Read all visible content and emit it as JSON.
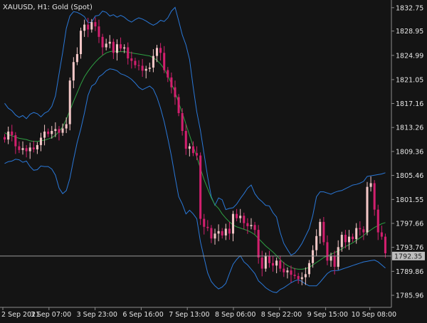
{
  "header": {
    "symbol_info": "XAUUSD, H1:  Gold (Spot)"
  },
  "colors": {
    "background": "#141414",
    "axis": "#8c8c8c",
    "text": "#e6e6e6",
    "bull_candle": "#f2c6c6",
    "bear_candle": "#d21f6e",
    "band": "#2a78d8",
    "middle_band": "#2ea043",
    "price_line": "#9a9a9a",
    "price_tag_bg": "#bdbdbd",
    "price_tag_text": "#202020"
  },
  "chart_data": {
    "type": "candlestick",
    "title": "XAUUSD, H1:  Gold (Spot)",
    "indicator": "Bollinger Bands",
    "y_ticks": [
      "1832.75",
      "1828.95",
      "1824.99",
      "1821.05",
      "1817.16",
      "1813.26",
      "1809.36",
      "1805.46",
      "1801.55",
      "1797.66",
      "1793.76",
      "1789.86",
      "1785.96"
    ],
    "x_ticks": [
      "2 Sep 2021",
      "3 Sep 07:00",
      "3 Sep 23:00",
      "6 Sep 16:00",
      "7 Sep 13:00",
      "8 Sep 06:00",
      "8 Sep 22:00",
      "9 Sep 15:00",
      "10 Sep 08:00"
    ],
    "ylim": [
      1784.0,
      1834.0
    ],
    "current_price": "1792.35",
    "candles_close": [
      1811.3,
      1812.6,
      1812.0,
      1810.2,
      1809.6,
      1809.9,
      1809.4,
      1810.0,
      1809.7,
      1810.4,
      1811.6,
      1812.6,
      1812.2,
      1812.7,
      1813.0,
      1812.4,
      1813.1,
      1813.8,
      1820.9,
      1823.9,
      1825.2,
      1829.0,
      1830.0,
      1829.2,
      1830.4,
      1829.7,
      1828.0,
      1826.3,
      1826.9,
      1827.2,
      1825.4,
      1826.8,
      1826.1,
      1826.3,
      1824.5,
      1824.1,
      1823.4,
      1823.3,
      1822.5,
      1822.8,
      1823.0,
      1824.9,
      1826.2,
      1825.4,
      1822.6,
      1821.4,
      1819.8,
      1818.2,
      1815.6,
      1812.7,
      1809.8,
      1810.2,
      1809.1,
      1808.7,
      1798.4,
      1797.1,
      1796.9,
      1795.2,
      1796.0,
      1796.4,
      1795.7,
      1796.8,
      1796.0,
      1799.2,
      1798.5,
      1798.9,
      1797.7,
      1797.2,
      1797.4,
      1796.6,
      1792.1,
      1790.3,
      1792.4,
      1791.2,
      1790.8,
      1791.6,
      1790.3,
      1789.7,
      1790.0,
      1789.3,
      1789.1,
      1788.6,
      1788.9,
      1789.4,
      1791.2,
      1793.3,
      1795.6,
      1797.9,
      1794.6,
      1791.6,
      1792.4,
      1790.6,
      1793.8,
      1795.8,
      1794.6,
      1795.5,
      1795.1,
      1796.9,
      1796.7,
      1796.2,
      1803.6,
      1804.2,
      1799.9,
      1796.2,
      1795.5,
      1792.8
    ],
    "upper_band": [
      1817.2,
      1816.4,
      1816.0,
      1815.3,
      1814.9,
      1815.2,
      1814.7,
      1815.4,
      1815.7,
      1815.5,
      1815.0,
      1815.6,
      1815.9,
      1816.7,
      1818.4,
      1822.0,
      1825.5,
      1829.4,
      1831.4,
      1832.1,
      1832.0,
      1831.7,
      1831.3,
      1830.3,
      1830.4,
      1831.4,
      1831.5,
      1832.2,
      1832.0,
      1831.4,
      1831.6,
      1831.2,
      1831.5,
      1831.2,
      1830.7,
      1830.4,
      1830.8,
      1831.1,
      1830.9,
      1830.6,
      1830.2,
      1829.9,
      1830.2,
      1830.7,
      1830.5,
      1831.1,
      1832.2,
      1832.8,
      1830.6,
      1828.3,
      1826.7,
      1824.3,
      1819.8,
      1815.8,
      1812.8,
      1809.0,
      1805.2,
      1802.0,
      1800.6,
      1801.8,
      1801.5,
      1799.9,
      1800.1,
      1800.2,
      1800.8,
      1801.7,
      1802.5,
      1803.4,
      1803.9,
      1802.5,
      1801.7,
      1801.2,
      1800.6,
      1800.5,
      1799.4,
      1798.7,
      1796.2,
      1794.4,
      1793.4,
      1792.5,
      1792.8,
      1793.5,
      1794.4,
      1795.6,
      1796.8,
      1799.0,
      1802.0,
      1802.8,
      1802.8,
      1802.6,
      1802.4,
      1802.7,
      1802.9,
      1803.0,
      1803.3,
      1803.6,
      1803.9,
      1804.0,
      1804.2,
      1804.5,
      1805.3,
      1805.4,
      1805.5,
      1805.6,
      1805.7,
      1805.9
    ],
    "middle_band": [
      1812.4,
      1812.1,
      1811.9,
      1811.7,
      1811.5,
      1811.4,
      1811.3,
      1811.1,
      1811.0,
      1811.0,
      1811.1,
      1811.2,
      1811.4,
      1811.6,
      1812.0,
      1812.6,
      1813.4,
      1814.6,
      1816.0,
      1817.5,
      1818.9,
      1820.3,
      1821.5,
      1822.4,
      1823.2,
      1823.9,
      1824.5,
      1825.0,
      1825.4,
      1825.6,
      1825.7,
      1825.6,
      1825.6,
      1825.6,
      1825.5,
      1825.4,
      1825.3,
      1825.2,
      1825.1,
      1825.0,
      1824.9,
      1824.6,
      1824.2,
      1823.6,
      1822.8,
      1821.7,
      1820.4,
      1819.0,
      1817.3,
      1815.6,
      1813.8,
      1812.0,
      1810.2,
      1808.5,
      1806.6,
      1804.8,
      1803.3,
      1801.8,
      1800.7,
      1800.1,
      1799.2,
      1798.5,
      1797.9,
      1797.4,
      1797.1,
      1796.9,
      1796.7,
      1796.5,
      1796.2,
      1795.8,
      1795.2,
      1794.6,
      1794.0,
      1793.5,
      1793.0,
      1792.4,
      1791.8,
      1791.2,
      1790.8,
      1790.5,
      1790.3,
      1790.2,
      1790.2,
      1790.3,
      1790.5,
      1790.9,
      1791.3,
      1791.7,
      1792.1,
      1792.4,
      1792.6,
      1792.9,
      1793.2,
      1793.5,
      1793.9,
      1794.2,
      1794.5,
      1794.9,
      1795.3,
      1795.7,
      1796.2,
      1796.6,
      1797.0,
      1797.3,
      1797.6,
      1797.8
    ],
    "lower_band": [
      1807.4,
      1807.7,
      1807.8,
      1808.1,
      1808.0,
      1807.6,
      1807.8,
      1806.9,
      1806.3,
      1806.4,
      1807.0,
      1806.9,
      1806.9,
      1806.5,
      1805.5,
      1803.4,
      1802.5,
      1803.0,
      1805.0,
      1808.0,
      1810.8,
      1813.0,
      1815.6,
      1818.5,
      1820.0,
      1820.4,
      1821.5,
      1821.9,
      1822.5,
      1822.8,
      1822.7,
      1822.5,
      1822.0,
      1821.8,
      1821.5,
      1821.1,
      1820.5,
      1819.8,
      1819.4,
      1819.7,
      1820.0,
      1819.5,
      1818.2,
      1816.4,
      1814.2,
      1811.5,
      1808.6,
      1805.2,
      1802.0,
      1800.8,
      1799.2,
      1799.8,
      1799.2,
      1798.4,
      1794.7,
      1792.1,
      1789.6,
      1788.2,
      1787.5,
      1787.0,
      1787.3,
      1787.9,
      1789.5,
      1791.0,
      1791.8,
      1792.4,
      1791.4,
      1790.9,
      1790.2,
      1789.5,
      1788.3,
      1787.8,
      1787.2,
      1786.8,
      1786.5,
      1786.4,
      1786.9,
      1787.2,
      1787.6,
      1788.0,
      1788.3,
      1788.5,
      1788.2,
      1787.8,
      1787.5,
      1787.5,
      1787.5,
      1788.1,
      1788.8,
      1789.5,
      1789.9,
      1790.0,
      1790.0,
      1790.2,
      1790.4,
      1790.6,
      1790.8,
      1791.0,
      1791.2,
      1791.4,
      1791.5,
      1791.6,
      1791.7,
      1791.4,
      1790.9,
      1790.4
    ]
  }
}
